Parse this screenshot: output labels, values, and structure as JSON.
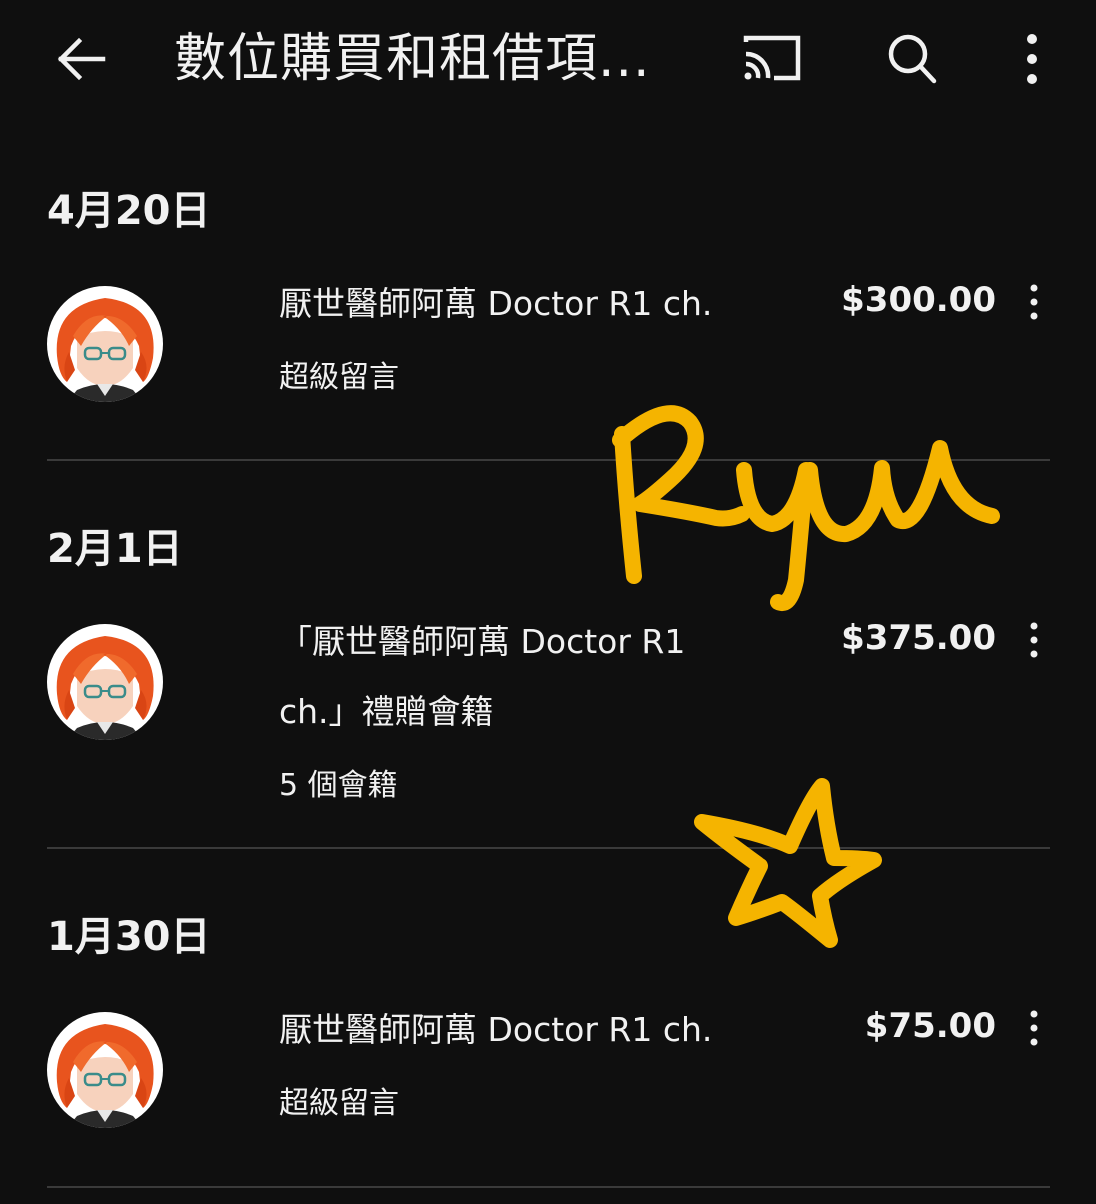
{
  "app_bar": {
    "title": "數位購買和租借項...",
    "icons": {
      "back": "arrow-left-icon",
      "cast": "cast-icon",
      "search": "search-icon",
      "more": "more-vertical-icon"
    }
  },
  "sections": [
    {
      "date": "4月20日",
      "item": {
        "title": "厭世醫師阿萬 Doctor R1 ch.",
        "subtitle": "超級留言",
        "price": "$300.00"
      }
    },
    {
      "date": "2月1日",
      "item": {
        "title_line1": "「厭世醫師阿萬 Doctor R1",
        "title_line2": "ch.」禮贈會籍",
        "subtitle": "5 個會籍",
        "price": "$375.00"
      }
    },
    {
      "date": "1月30日",
      "item": {
        "title": "厭世醫師阿萬 Doctor R1 ch.",
        "subtitle": "超級留言",
        "price": "$75.00"
      }
    }
  ],
  "overlay": {
    "handwriting_text": "Ryu",
    "ink_color": "#f5b400"
  },
  "colors": {
    "background": "#0f0f0f",
    "text": "#f1f1f1",
    "divider": "#3a3a3a",
    "avatar_hair": "#e8541e",
    "avatar_bg": "#ffffff"
  }
}
